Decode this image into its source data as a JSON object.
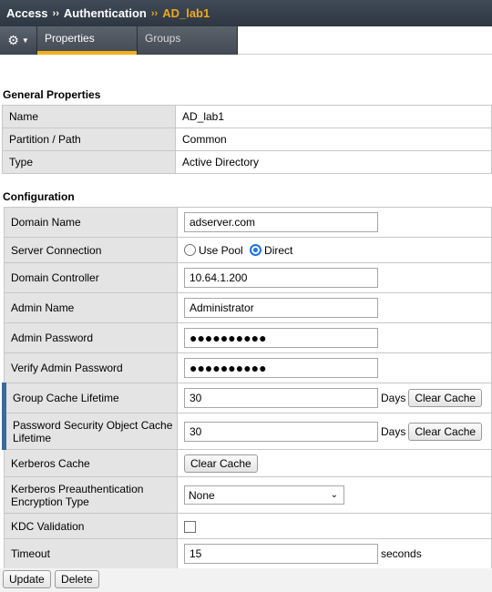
{
  "breadcrumb": {
    "part1": "Access",
    "part2": "Authentication",
    "part3": "AD_lab1",
    "sep": "››"
  },
  "tabs": [
    {
      "label": "Properties"
    },
    {
      "label": "Groups"
    }
  ],
  "general": {
    "title": "General Properties",
    "rows": [
      {
        "label": "Name",
        "value": "AD_lab1"
      },
      {
        "label": "Partition / Path",
        "value": "Common"
      },
      {
        "label": "Type",
        "value": "Active Directory"
      }
    ]
  },
  "config": {
    "title": "Configuration",
    "domain_name": {
      "label": "Domain Name",
      "value": "adserver.com"
    },
    "server_connection": {
      "label": "Server Connection",
      "option_pool": "Use Pool",
      "option_direct": "Direct",
      "selected": "Direct"
    },
    "domain_controller": {
      "label": "Domain Controller",
      "value": "10.64.1.200"
    },
    "admin_name": {
      "label": "Admin Name",
      "value": "Administrator"
    },
    "admin_password": {
      "label": "Admin Password",
      "value": "●●●●●●●●●●"
    },
    "verify_password": {
      "label": "Verify Admin Password",
      "value": "●●●●●●●●●●"
    },
    "group_cache": {
      "label": "Group Cache Lifetime",
      "value": "30",
      "unit": "Days",
      "button": "Clear Cache"
    },
    "pwd_cache": {
      "label": "Password Security Object Cache Lifetime",
      "value": "30",
      "unit": "Days",
      "button": "Clear Cache"
    },
    "kerberos_cache": {
      "label": "Kerberos Cache",
      "button": "Clear Cache"
    },
    "kerberos_preauth": {
      "label": "Kerberos Preauthentication Encryption Type",
      "value": "None"
    },
    "kdc_validation": {
      "label": "KDC Validation",
      "checked": false
    },
    "timeout": {
      "label": "Timeout",
      "value": "15",
      "unit": "seconds"
    }
  },
  "actions": {
    "update": "Update",
    "delete": "Delete"
  },
  "colors": {
    "accent": "#f0b01a",
    "header_bg": "#3f4a57",
    "marker": "#3b6a9e",
    "radio": "#1a73e8"
  },
  "icons": {
    "settings": "gear-icon",
    "dropdown": "chevron-down-icon"
  }
}
